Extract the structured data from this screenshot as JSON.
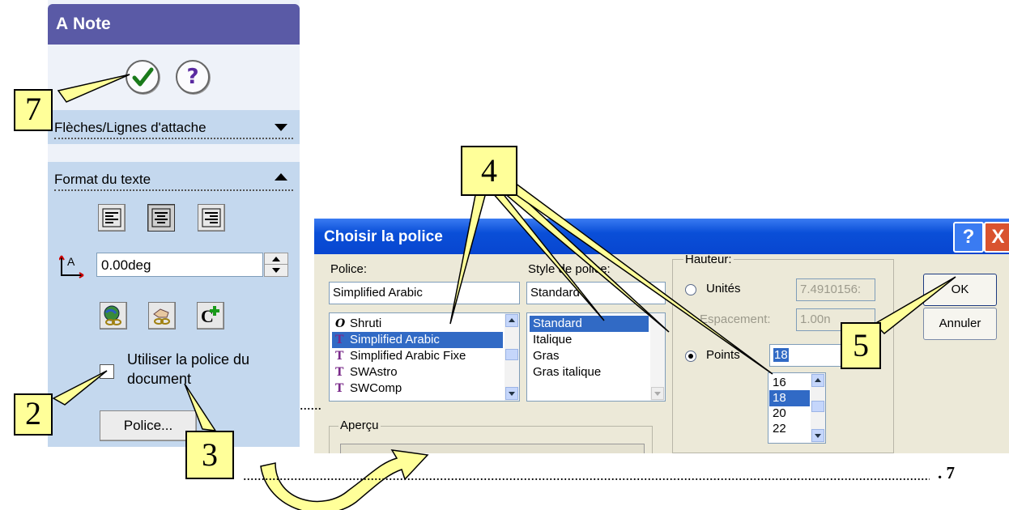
{
  "note_panel": {
    "title": "Note",
    "title_icon": "A",
    "ok_icon": "check-icon",
    "help_glyph": "?",
    "group1_label": "Flèches/Lignes d'attache",
    "group2_label": "Format du texte",
    "angle_value": "0.00deg",
    "use_doc_font_label": "Utiliser la police du document",
    "police_button": "Police..."
  },
  "font_dialog": {
    "title": "Choisir la police",
    "help_glyph": "?",
    "close_glyph": "X",
    "police_label": "Police:",
    "police_value": "Simplified Arabic",
    "font_list": [
      {
        "icon": "O",
        "name": "Shruti",
        "selected": false
      },
      {
        "icon": "T",
        "name": "Simplified Arabic",
        "selected": true
      },
      {
        "icon": "T",
        "name": "Simplified Arabic Fixe",
        "selected": false
      },
      {
        "icon": "T",
        "name": "SWAstro",
        "selected": false
      },
      {
        "icon": "T",
        "name": "SWComp",
        "selected": false
      }
    ],
    "style_label": "Style de police:",
    "style_value": "Standard",
    "style_list": [
      {
        "name": "Standard",
        "selected": true
      },
      {
        "name": "Italique",
        "selected": false
      },
      {
        "name": "Gras",
        "selected": false
      },
      {
        "name": "Gras italique",
        "selected": false
      }
    ],
    "height_label": "Hauteur:",
    "units_label": "Unités",
    "units_value": "7.4910156:",
    "spacing_label": "Espacement:",
    "spacing_value": "1.00n",
    "points_label": "Points",
    "points_value": "18",
    "size_list": [
      {
        "name": "16",
        "selected": false
      },
      {
        "name": "18",
        "selected": true
      },
      {
        "name": "20",
        "selected": false
      },
      {
        "name": "22",
        "selected": false
      }
    ],
    "ok_button": "OK",
    "cancel_button": "Annuler",
    "preview_label": "Aperçu"
  },
  "annotations": {
    "callouts": [
      "7",
      "2",
      "3",
      "4",
      "5"
    ],
    "question_number": ". 7",
    "callout_color": "#ffff99"
  }
}
